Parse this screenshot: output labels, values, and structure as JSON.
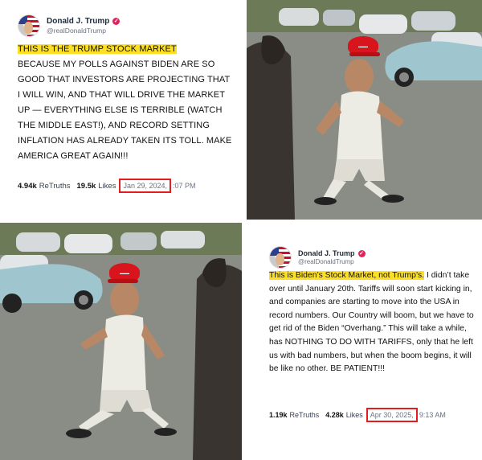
{
  "post1": {
    "name": "Donald J. Trump",
    "handle": "@realDonaldTrump",
    "highlight": "THIS IS THE TRUMP STOCK MARKET",
    "body": "BECAUSE MY POLLS AGAINST BIDEN ARE SO GOOD THAT INVESTORS ARE PROJECTING THAT I WILL WIN, AND THAT WILL DRIVE THE MARKET UP — EVERYTHING ELSE IS TERRIBLE (WATCH THE MIDDLE EAST!), AND RECORD SETTING INFLATION HAS ALREADY TAKEN ITS TOLL. MAKE AMERICA GREAT AGAIN!!!",
    "retruths_count": "4.94k",
    "retruths_label": "ReTruths",
    "likes_count": "19.5k",
    "likes_label": "Likes",
    "date": "Jan 29, 2024,",
    "time": ":07 PM"
  },
  "post2": {
    "name": "Donald J. Trump",
    "handle": "@realDonaldTrump",
    "highlight": "This is Biden’s Stock Market, not Trump’s.",
    "body": "I didn’t take over until January 20th. Tariffs will soon start kicking in, and companies are starting to move into the USA in record numbers. Our Country will boom, but we have to get rid of the Biden “Overhang.” This will take a while, has NOTHING TO DO WITH TARIFFS, only that he left us with bad numbers, but when the boom begins, it will be like no other. BE PATIENT!!!",
    "retruths_count": "1.19k",
    "retruths_label": "ReTruths",
    "likes_count": "4.28k",
    "likes_label": "Likes",
    "date": "Apr 30, 2025,",
    "time": "9:13 AM"
  },
  "colors": {
    "highlight": "#fde023",
    "date_box_border": "#e11d1d",
    "hat": "#d8141c"
  },
  "icons": [
    "verified-badge-icon",
    "avatar-flag-icon"
  ]
}
